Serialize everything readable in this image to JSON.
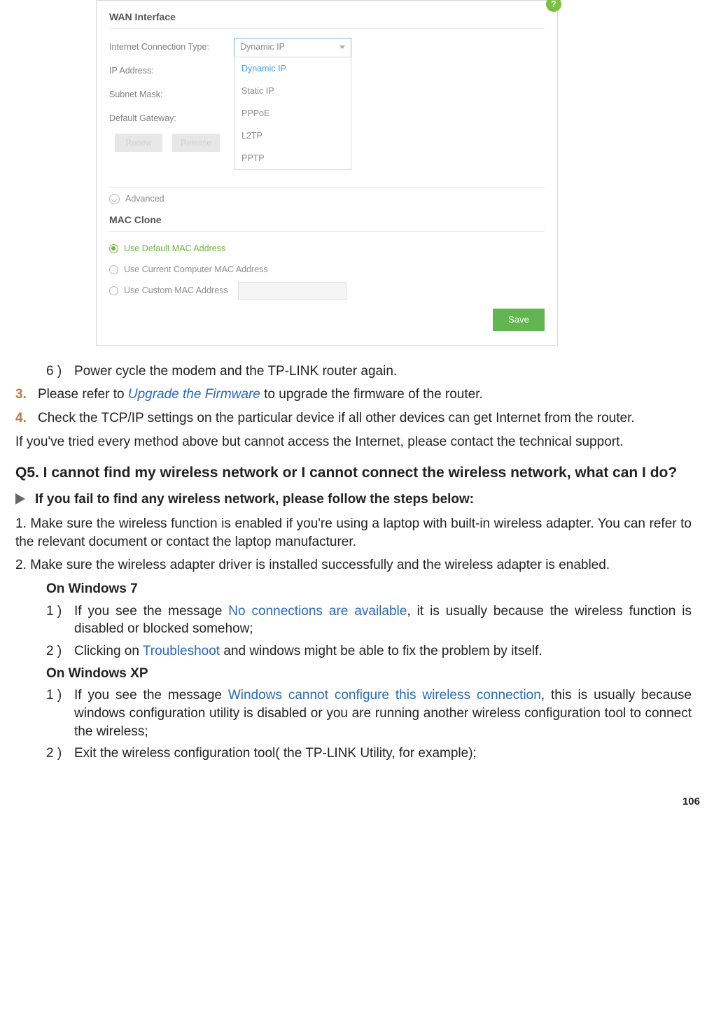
{
  "ui": {
    "help_icon": "?",
    "section_wan": "WAN Interface",
    "labels": {
      "conn_type": "Internet Connection Type:",
      "ip": "IP Address:",
      "subnet": "Subnet Mask:",
      "gateway": "Default Gateway:"
    },
    "select_value": "Dynamic IP",
    "options": {
      "dynamic": "Dynamic IP",
      "static": "Static IP",
      "pppoe": "PPPoE",
      "l2tp": "L2TP",
      "pptp": "PPTP"
    },
    "btn_renew": "Renew",
    "btn_release": "Release",
    "advanced": "Advanced",
    "section_mac": "MAC Clone",
    "mac_options": {
      "default": "Use Default MAC Address",
      "current": "Use Current Computer MAC Address",
      "custom": "Use Custom MAC Address"
    },
    "save": "Save"
  },
  "doc": {
    "step6_marker": "6 )",
    "step6": "Power cycle the modem and the TP-LINK router again.",
    "item3_marker": "3.",
    "item3_pre": "Please refer to ",
    "item3_link": "Upgrade the Firmware",
    "item3_post": " to upgrade the firmware of the router.",
    "item4_marker": "4.",
    "item4": "Check the TCP/IP settings on the particular device if all other devices can get Internet from the router.",
    "fallback": "If you've tried every method above but cannot access the Internet, please contact the technical support.",
    "q5": "Q5. I cannot find my wireless network or I cannot connect the wireless network, what can I do?",
    "tri1": "If you fail to find any wireless network, please follow the steps below:",
    "p1": "1. Make sure the wireless function is enabled if you're using a laptop with built-in wireless adapter. You can refer to the relevant document or contact the laptop manufacturer.",
    "p2": "2. Make sure the wireless adapter driver is installed successfully and the wireless adapter is enabled.",
    "win7": "On Windows 7",
    "w7_1_m": "1 )",
    "w7_1_pre": "If you see the message ",
    "w7_1_link": "No connections are available",
    "w7_1_post": ", it is usually because the wireless function is disabled or blocked somehow;",
    "w7_2_m": "2 )",
    "w7_2_pre": "Clicking on ",
    "w7_2_link": "Troubleshoot",
    "w7_2_post": " and windows might be able to fix the problem by itself.",
    "winxp": "On Windows XP",
    "xp_1_m": "1 )",
    "xp_1_pre": "If you see the message ",
    "xp_1_link": "Windows cannot configure this wireless connection",
    "xp_1_post": ", this is usually because windows configuration utility is disabled or you are running another wireless configuration tool to connect the wireless;",
    "xp_2_m": "2 )",
    "xp_2": "Exit the wireless configuration tool( the TP-LINK Utility, for example);",
    "page": "106"
  }
}
